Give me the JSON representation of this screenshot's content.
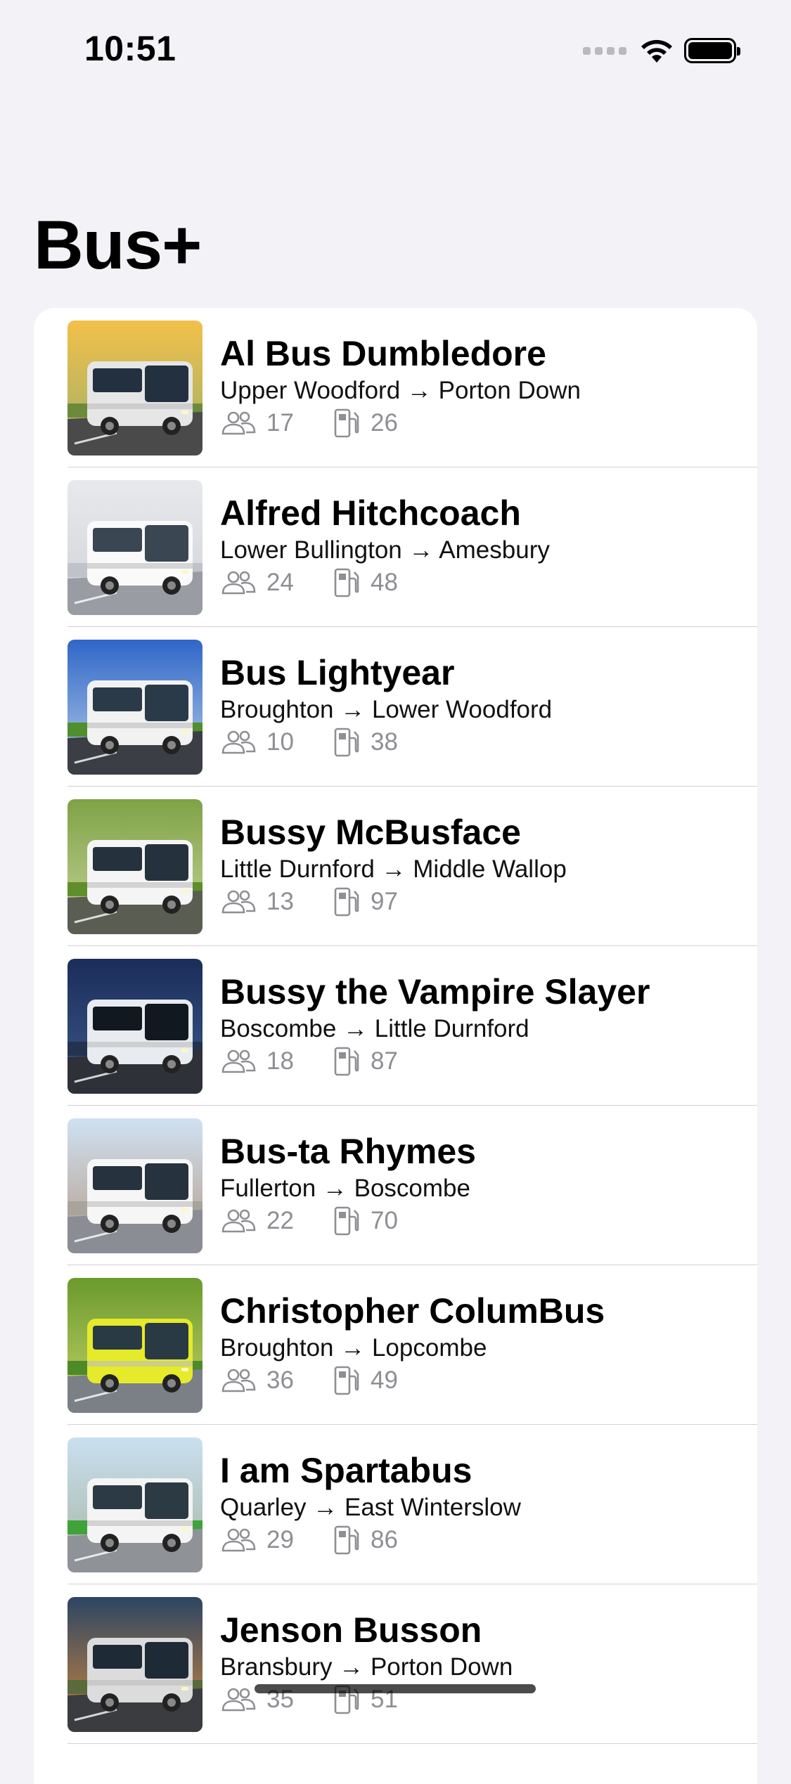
{
  "status_bar": {
    "time": "10:51"
  },
  "title": "Bus+",
  "buses": [
    {
      "name": "Al Bus Dumbledore",
      "route": "Upper Woodford → Porton Down",
      "seats": "17",
      "fuel": "26",
      "photo": "bus-photo-sunset"
    },
    {
      "name": "Alfred Hitchcoach",
      "route": "Lower Bullington → Amesbury",
      "seats": "24",
      "fuel": "48",
      "photo": "bus-photo-white-road"
    },
    {
      "name": "Bus Lightyear",
      "route": "Broughton → Lower Woodford",
      "seats": "10",
      "fuel": "38",
      "photo": "bus-photo-blue-sky"
    },
    {
      "name": "Bussy McBusface",
      "route": "Little Durnford → Middle Wallop",
      "seats": "13",
      "fuel": "97",
      "photo": "bus-photo-green-hill"
    },
    {
      "name": "Bussy the Vampire Slayer",
      "route": "Boscombe → Little Durnford",
      "seats": "18",
      "fuel": "87",
      "photo": "bus-photo-night"
    },
    {
      "name": "Bus-ta Rhymes",
      "route": "Fullerton → Boscombe",
      "seats": "22",
      "fuel": "70",
      "photo": "bus-photo-city"
    },
    {
      "name": "Christopher ColumBus",
      "route": "Broughton → Lopcombe",
      "seats": "36",
      "fuel": "49",
      "photo": "bus-photo-yellow"
    },
    {
      "name": "I am Spartabus",
      "route": "Quarley → East Winterslow",
      "seats": "29",
      "fuel": "86",
      "photo": "bus-photo-green-city"
    },
    {
      "name": "Jenson Busson",
      "route": "Bransbury → Porton Down",
      "seats": "35",
      "fuel": "51",
      "photo": "bus-photo-dusk"
    }
  ]
}
